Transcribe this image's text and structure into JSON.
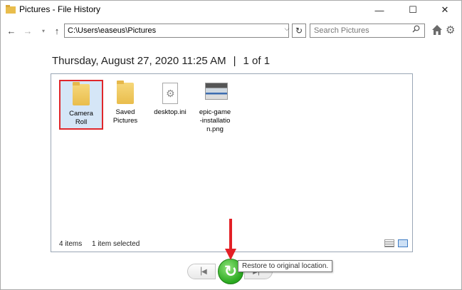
{
  "window": {
    "title": "Pictures - File History",
    "controls": {
      "minimize": "—",
      "maximize": "☐",
      "close": "✕"
    }
  },
  "nav": {
    "back_icon": "arrow-left-icon",
    "forward_icon": "arrow-right-icon",
    "up_icon": "arrow-up-icon",
    "address": "C:\\Users\\easeus\\Pictures",
    "search_placeholder": "Search Pictures"
  },
  "header": {
    "date": "Thursday, August 27, 2020 11:25 AM",
    "separator": "|",
    "page": "1 of 1"
  },
  "files": [
    {
      "name_line1": "Camera",
      "name_line2": "Roll",
      "type": "folder",
      "selected": true
    },
    {
      "name_line1": "Saved",
      "name_line2": "Pictures",
      "type": "folder",
      "selected": false
    },
    {
      "name_line1": "desktop.ini",
      "name_line2": "",
      "type": "settings-file",
      "selected": false
    },
    {
      "name_line1": "epic-game",
      "name_line2": "-installatio",
      "name_line3": "n.png",
      "type": "image-file",
      "selected": false
    }
  ],
  "status": {
    "count": "4 items",
    "selection": "1 item selected"
  },
  "controls": {
    "restore_tooltip": "Restore to original location."
  },
  "colors": {
    "selection_outline": "#e0272b",
    "restore_green": "#29a81f",
    "annotation_arrow": "#e32026"
  }
}
